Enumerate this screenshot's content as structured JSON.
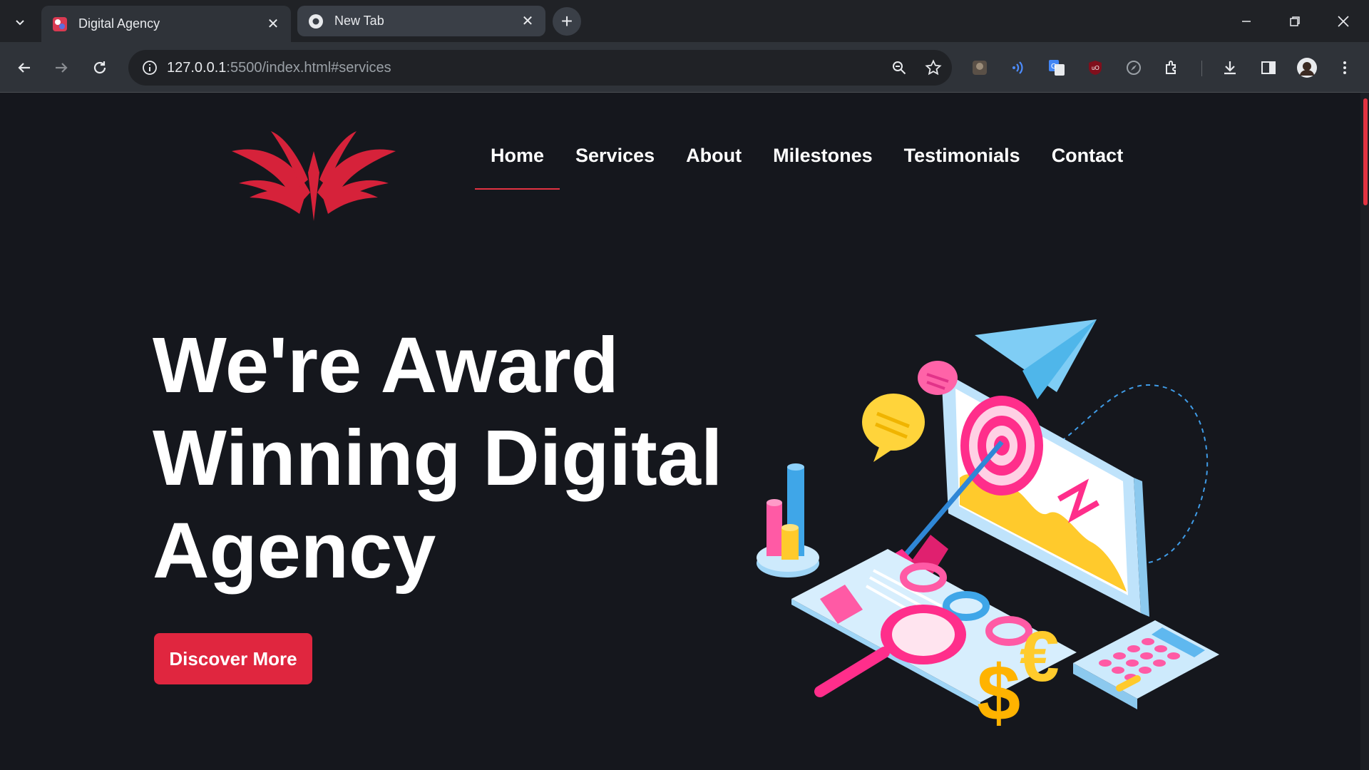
{
  "browser": {
    "tabs": [
      {
        "title": "Digital Agency",
        "active": true,
        "favicon": "agency-favicon"
      },
      {
        "title": "New Tab",
        "active": false,
        "favicon": "chrome-icon"
      }
    ],
    "url_host": "127.0.0.1",
    "url_rest": ":5500/index.html#services",
    "close_symbol": "✕",
    "newtab_symbol": "+"
  },
  "site": {
    "nav": [
      "Home",
      "Services",
      "About",
      "Milestones",
      "Testimonials",
      "Contact"
    ],
    "active_nav": "Home",
    "hero_line1": "We're Award",
    "hero_line2": "Winning Digital",
    "hero_line3": "Agency",
    "cta_label": "Discover More"
  },
  "colors": {
    "accent": "#e0263f",
    "bg": "#15171d"
  }
}
